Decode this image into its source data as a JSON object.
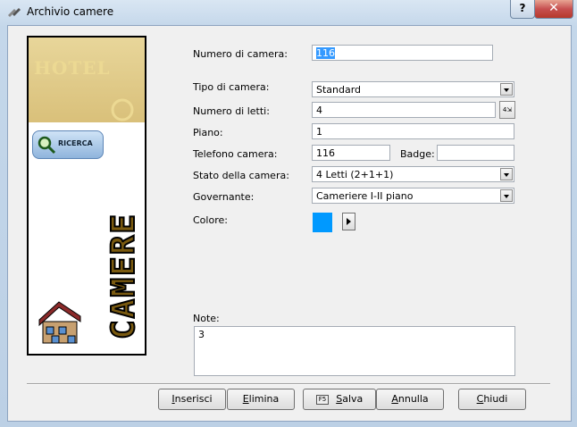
{
  "window": {
    "title": "Archivio camere"
  },
  "titlebar": {
    "help_label": "?",
    "close_label": "✕"
  },
  "sidebar": {
    "hotel_text": "HOTEL",
    "search_label": "RICERCA",
    "vertical_text": "CAMERE"
  },
  "form": {
    "room_number": {
      "label": "Numero di camera:",
      "value": "116"
    },
    "room_type": {
      "label": "Tipo di camera:",
      "value": "Standard"
    },
    "beds": {
      "label": "Numero di letti:",
      "value": "4",
      "button_label": "4⇲"
    },
    "floor": {
      "label": "Piano:",
      "value": "1"
    },
    "phone": {
      "label": "Telefono camera:",
      "value": "116"
    },
    "badge": {
      "label": "Badge:",
      "value": ""
    },
    "status": {
      "label": "Stato della camera:",
      "value": "4 Letti (2+1+1)"
    },
    "housekeeper": {
      "label": "Governante:",
      "value": "Cameriere I-II piano"
    },
    "color": {
      "label": "Colore:",
      "swatch": "#0099ff"
    },
    "notes": {
      "label": "Note:",
      "value": "3"
    }
  },
  "buttons": {
    "insert": {
      "first": "I",
      "rest": "nserisci"
    },
    "delete": {
      "first": "E",
      "rest": "limina"
    },
    "save": {
      "badge": "F5",
      "first": "S",
      "rest": "alva"
    },
    "cancel": {
      "first": "A",
      "rest": "nnulla"
    },
    "close": {
      "first": "C",
      "rest": "hiudi"
    }
  }
}
